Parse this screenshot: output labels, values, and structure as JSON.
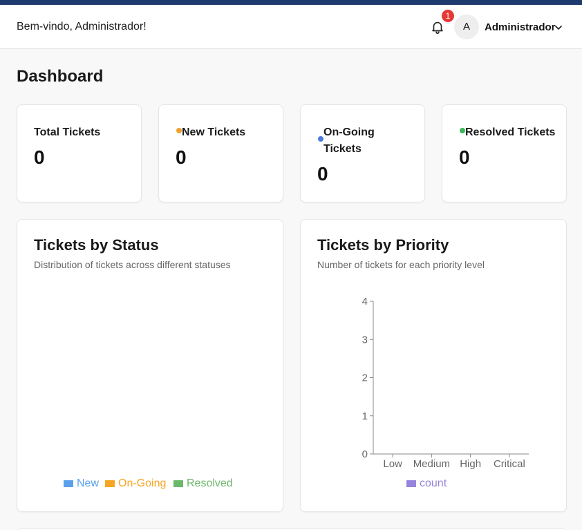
{
  "header": {
    "welcome": "Bem-vindo, Administrador!",
    "notification_count": "1",
    "avatar_initial": "A",
    "username": "Administrador"
  },
  "page": {
    "title": "Dashboard"
  },
  "stats": [
    {
      "label": "Total Tickets",
      "value": "0",
      "dot_color": ""
    },
    {
      "label": "New Tickets",
      "value": "0",
      "dot_color": "#f0a030"
    },
    {
      "label": "On-Going Tickets",
      "value": "0",
      "dot_color": "#4a7be0"
    },
    {
      "label": "Resolved Tickets",
      "value": "0",
      "dot_color": "#3cb85a"
    }
  ],
  "colors": {
    "accent_topbar": "#1e3a6e",
    "badge": "#e53935",
    "new": "#5aa0ea",
    "ongoing": "#f5a623",
    "resolved": "#6bb86b",
    "count": "#9683dc"
  },
  "status_chart": {
    "title": "Tickets by Status",
    "subtitle": "Distribution of tickets across different statuses",
    "legend": [
      {
        "name": "New",
        "color": "#5aa0ea"
      },
      {
        "name": "On-Going",
        "color": "#f5a623"
      },
      {
        "name": "Resolved",
        "color": "#6bb86b"
      }
    ]
  },
  "priority_chart": {
    "title": "Tickets by Priority",
    "subtitle": "Number of tickets for each priority level",
    "legend": [
      {
        "name": "count",
        "color": "#9683dc"
      }
    ]
  },
  "chart_data": [
    {
      "type": "pie",
      "title": "Tickets by Status",
      "categories": [
        "New",
        "On-Going",
        "Resolved"
      ],
      "values": [
        0,
        0,
        0
      ],
      "legend": "bottom"
    },
    {
      "type": "bar",
      "title": "Tickets by Priority",
      "categories": [
        "Low",
        "Medium",
        "High",
        "Critical"
      ],
      "series": [
        {
          "name": "count",
          "values": [
            0,
            0,
            0,
            0
          ]
        }
      ],
      "yticks": [
        "0",
        "1",
        "2",
        "3",
        "4"
      ],
      "ylim": [
        0,
        4
      ],
      "grid": false,
      "legend": "bottom"
    }
  ]
}
